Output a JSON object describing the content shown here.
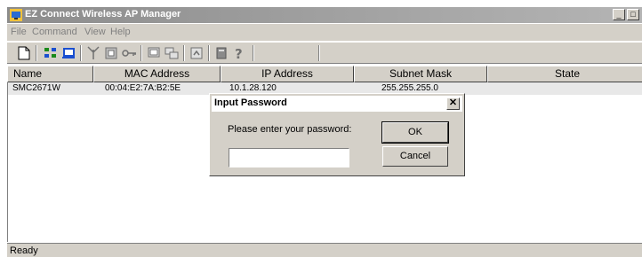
{
  "window": {
    "title": "EZ Connect Wireless AP Manager",
    "min_glyph": "_",
    "max_glyph": "□"
  },
  "menu": {
    "items": [
      "File",
      "Command",
      "View",
      "Help"
    ]
  },
  "toolbar": {
    "icons": [
      "new-icon",
      "scan-icon",
      "connect-icon",
      "antenna-icon",
      "settings-icon",
      "key-icon",
      "monitor-icon",
      "network-icon",
      "upgrade-icon",
      "book-icon",
      "help-icon"
    ]
  },
  "list": {
    "columns": [
      "Name",
      "MAC Address",
      "IP Address",
      "Subnet Mask",
      "State"
    ],
    "rows": [
      {
        "name": "SMC2671W",
        "mac": "00:04:E2:7A:B2:5E",
        "ip": "10.1.28.120",
        "subnet": "255.255.255.0",
        "state": ""
      }
    ]
  },
  "status": {
    "text": "Ready"
  },
  "dialog": {
    "title": "Input Password",
    "close": "✕",
    "label": "Please enter your password:",
    "password_value": "",
    "ok_label": "OK",
    "cancel_label": "Cancel"
  }
}
